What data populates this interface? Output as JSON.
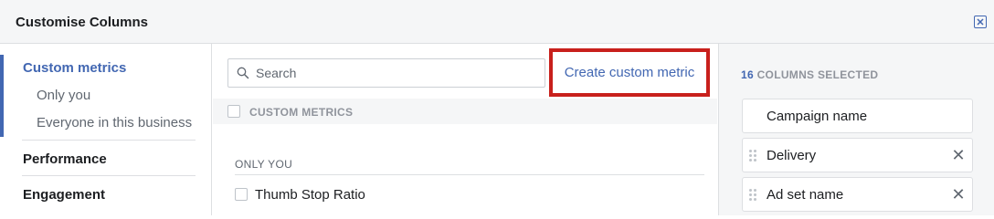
{
  "header": {
    "title": "Customise Columns"
  },
  "sidebar": {
    "sections": [
      {
        "label": "Custom metrics",
        "subitems": [
          "Only you",
          "Everyone in this business"
        ]
      },
      {
        "label": "Performance"
      },
      {
        "label": "Engagement"
      }
    ]
  },
  "search": {
    "placeholder": "Search"
  },
  "create_link": "Create custom metric",
  "custom_metrics_header": "CUSTOM METRICS",
  "only_you_header": "ONLY YOU",
  "metrics": [
    {
      "label": "Thumb Stop Ratio",
      "checked": false
    }
  ],
  "selected": {
    "count": "16",
    "label": "COLUMNS SELECTED",
    "columns": [
      "Campaign name",
      "Delivery",
      "Ad set name"
    ]
  },
  "colors": {
    "accent": "#4267b2",
    "highlight_border": "#c8201c"
  },
  "icons": {
    "close": "close-box-icon",
    "search": "search-icon",
    "drag": "drag-handle-icon",
    "remove": "remove-x-icon"
  }
}
